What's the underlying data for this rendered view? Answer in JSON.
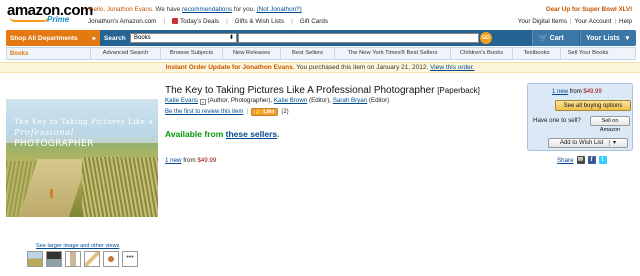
{
  "logo": {
    "text": "amazon.com",
    "prime": "Prime"
  },
  "header": {
    "greeting_prefix": "Hello, Jonathon Evans.",
    "greeting_mid": "We have",
    "recommendations": "recommendations",
    "for_you": "for you.",
    "not_you": "(Not Jonathon?)",
    "superbowl": "Gear Up for Super Bowl XLVI",
    "nav": [
      "Jonathon's Amazon.com",
      "Today's Deals",
      "Gifts & Wish Lists",
      "Gift Cards"
    ],
    "account": [
      "Your Digital Items",
      "|",
      "Your Account",
      "|",
      "Help"
    ]
  },
  "search": {
    "shop_all": "Shop All Departments",
    "label": "Search",
    "department": "Books",
    "go": "GO",
    "cart": "Cart",
    "lists": "Your Lists"
  },
  "subnav": {
    "store": "Books",
    "items": [
      "Advanced Search",
      "Browse Subjects",
      "New Releases",
      "Best Sellers",
      "The New York Times® Best Sellers",
      "Children's Books",
      "Textbooks",
      "Sell Your Books"
    ]
  },
  "update": {
    "lead": "Instant Order Update for Jonathon Evans.",
    "rest": "You purchased this item on January 21, 2012.",
    "link": "View this order."
  },
  "product": {
    "title": "The Key to Taking Pictures Like A Professional Photographer",
    "format": "[Paperback]",
    "author1": "Katie Evans",
    "author1_role": "(Author, Photographer),",
    "author2": "Katie Brown",
    "author2_role": "(Editor),",
    "author3": "Sarah Bryan",
    "author3_role": "(Editor)",
    "review_link": "Be the first to review this item",
    "like_label": "Like",
    "like_count": "(2)",
    "available_prefix": "Available from",
    "available_link": "these sellers",
    "available_suffix": ".",
    "new_count": "1 new",
    "new_from": "from",
    "new_price": "$49.99",
    "cover": {
      "line1": "The Key to Taking Pictures Like a",
      "line2": "Professional",
      "line3": "PHOTOGRAPHER"
    }
  },
  "buybox": {
    "new_count": "1 new",
    "new_from": "from",
    "new_price": "$49.99",
    "all_options": "See all buying options",
    "have_one": "Have one to sell?",
    "sell_button": "Sell on Amazon",
    "wish_button": "Add to Wish List"
  },
  "share": {
    "label": "Share"
  },
  "gallery": {
    "link": "See larger image and other views"
  },
  "colors": {
    "orange": "#e47911",
    "navy": "#246392",
    "link": "#004b91",
    "price": "#990000",
    "available": "#009900"
  }
}
